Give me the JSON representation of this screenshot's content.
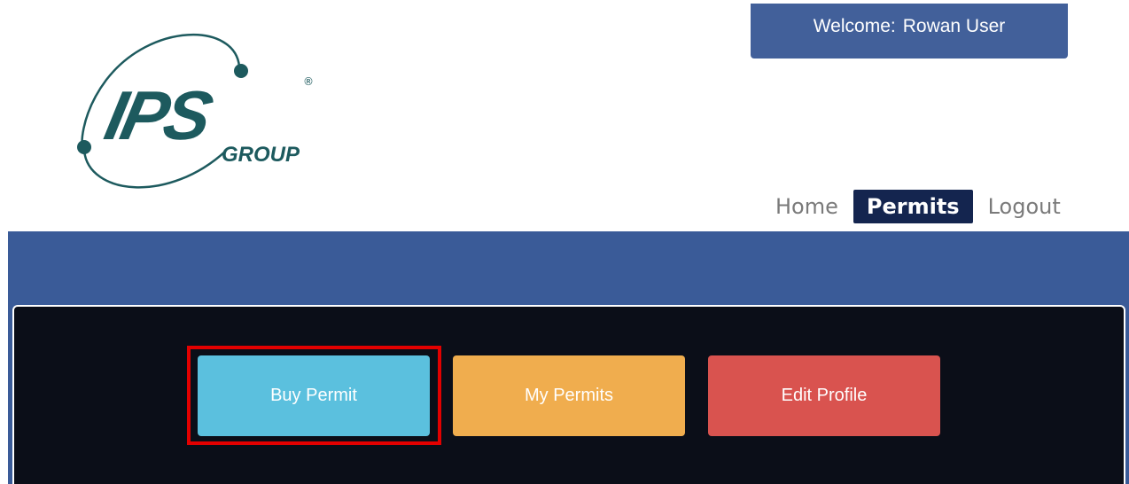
{
  "brand": {
    "logo_text": "IPS",
    "logo_subtext": "GROUP",
    "logo_mark": "®",
    "logo_color": "#1d5a5e"
  },
  "header": {
    "welcome_label": "Welcome:",
    "user_name": "Rowan User"
  },
  "nav": {
    "items": [
      {
        "label": "Home",
        "active": false
      },
      {
        "label": "Permits",
        "active": true
      },
      {
        "label": "Logout",
        "active": false
      }
    ]
  },
  "actions": {
    "buy_permit": "Buy Permit",
    "my_permits": "My Permits",
    "edit_profile": "Edit Profile"
  },
  "colors": {
    "header_blue": "#42609a",
    "band_blue": "#3a5b98",
    "nav_active": "#14254f",
    "panel": "#0b0e18",
    "buy": "#5bc0de",
    "my": "#f0ad4e",
    "edit": "#d9534f",
    "highlight": "#e30000"
  }
}
